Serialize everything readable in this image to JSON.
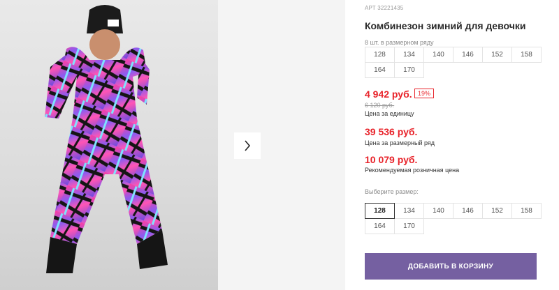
{
  "product": {
    "article": "АРТ 32221435",
    "title": "Комбинезон зимний для девочки"
  },
  "pack": {
    "label": "8 шт. в размерном ряду",
    "sizes": [
      "128",
      "134",
      "140",
      "146",
      "152",
      "158",
      "164",
      "170"
    ]
  },
  "pricing": {
    "unit_price": "4 942 руб.",
    "discount": "19%",
    "old_price": "6 120 руб.",
    "unit_caption": "Цена за единицу",
    "pack_price": "39 536 руб.",
    "pack_caption": "Цена за размерный ряд",
    "rrp_price": "10 079 руб.",
    "rrp_caption": "Рекомендуемая розничная цена"
  },
  "size_picker": {
    "label": "Выберите размер:",
    "sizes": [
      "128",
      "134",
      "140",
      "146",
      "152",
      "158",
      "164",
      "170"
    ],
    "selected": "128"
  },
  "cart": {
    "button_label": "ДОБАВИТЬ В КОРЗИНУ"
  },
  "gallery": {
    "next_icon": "chevron-right-icon"
  },
  "colors": {
    "accent": "#7560a1",
    "price": "#e8232a"
  }
}
